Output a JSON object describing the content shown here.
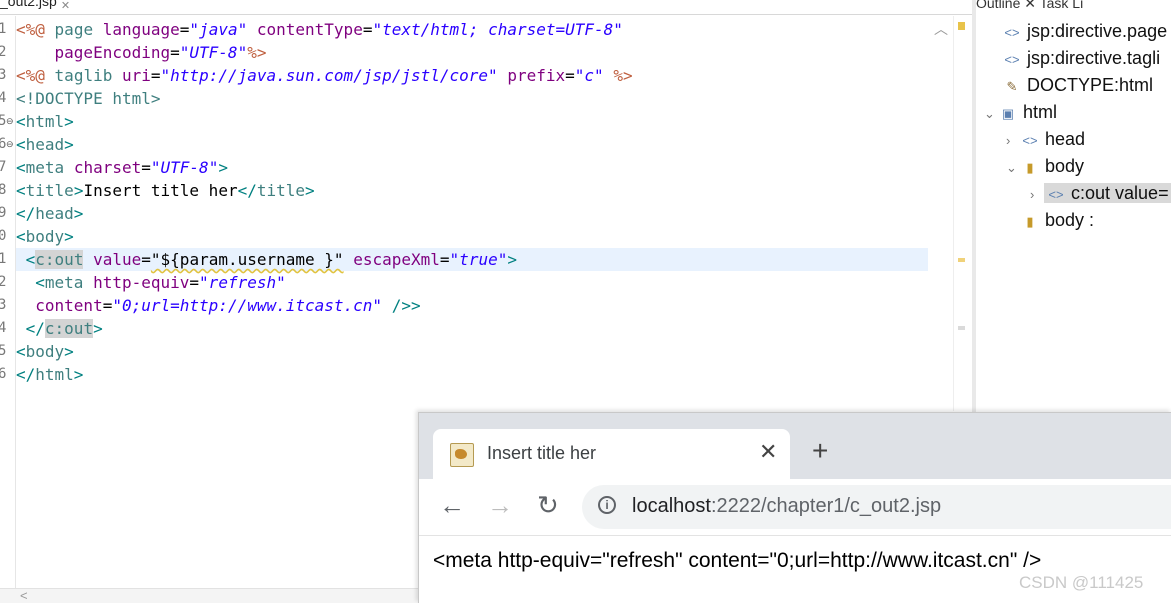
{
  "editor": {
    "tab_label": "_out2.jsp",
    "tab_close": "✕",
    "line_numbers": [
      "1",
      "2",
      "3",
      "4",
      "5",
      "6",
      "7",
      "8",
      "9",
      "0",
      "1",
      "2",
      "3",
      "4",
      "5",
      "6"
    ],
    "code": {
      "l1_dir_open": "<%@",
      "l1_kw": "page",
      "l1_attr1": "language",
      "l1_val1": "\"java\"",
      "l1_attr2": "contentType",
      "l1_val2": "\"text/html; charset=UTF-8\"",
      "l2_attr": "pageEncoding",
      "l2_val": "\"UTF-8\"",
      "l2_close": "%>",
      "l3_kw": "taglib",
      "l3_attr1": "uri",
      "l3_val1": "\"http://java.sun.com/jsp/jstl/core\"",
      "l3_attr2": "prefix",
      "l3_val2": "\"c\"",
      "l3_close": "%>",
      "l4": "<!DOCTYPE html>",
      "tag_html": "html",
      "tag_head": "head",
      "tag_meta": "meta",
      "attr_charset": "charset",
      "val_charset": "\"UTF-8\"",
      "tag_title": "title",
      "title_text": "Insert title her",
      "tag_body": "body",
      "tag_cout": "c:out",
      "attr_value": "value",
      "val_value": "\"${param.username }\"",
      "attr_escape": "escapeXml",
      "val_escape": "\"true\"",
      "attr_http_equiv": "http-equiv",
      "val_http_equiv": "\"refresh\"",
      "attr_content": "content",
      "val_content": "\"0;url=http://www.itcast.cn\"",
      "selfclose": " />"
    }
  },
  "outline": {
    "tabs": "Outline ✕  Task Li",
    "items": [
      {
        "label": "jsp:directive.page"
      },
      {
        "label": "jsp:directive.tagli"
      },
      {
        "label": "DOCTYPE:html"
      },
      {
        "label": "html"
      },
      {
        "label": "head"
      },
      {
        "label": "body"
      },
      {
        "label": "c:out value="
      },
      {
        "label": "body :"
      }
    ]
  },
  "browser": {
    "tab_title": "Insert title her",
    "tab_close": "✕",
    "new_tab": "+",
    "url_host": "localhost",
    "url_rest": ":2222/chapter1/c_out2.jsp",
    "page_text": "<meta http-equiv=\"refresh\" content=\"0;url=http://www.itcast.cn\" />"
  },
  "watermark": "CSDN @111425",
  "colors": {
    "tag": "#3f7f7f",
    "attribute": "#7f007f",
    "string": "#2a00ff",
    "directive": "#bf5f3f",
    "current_line": "#e8f2fe"
  }
}
